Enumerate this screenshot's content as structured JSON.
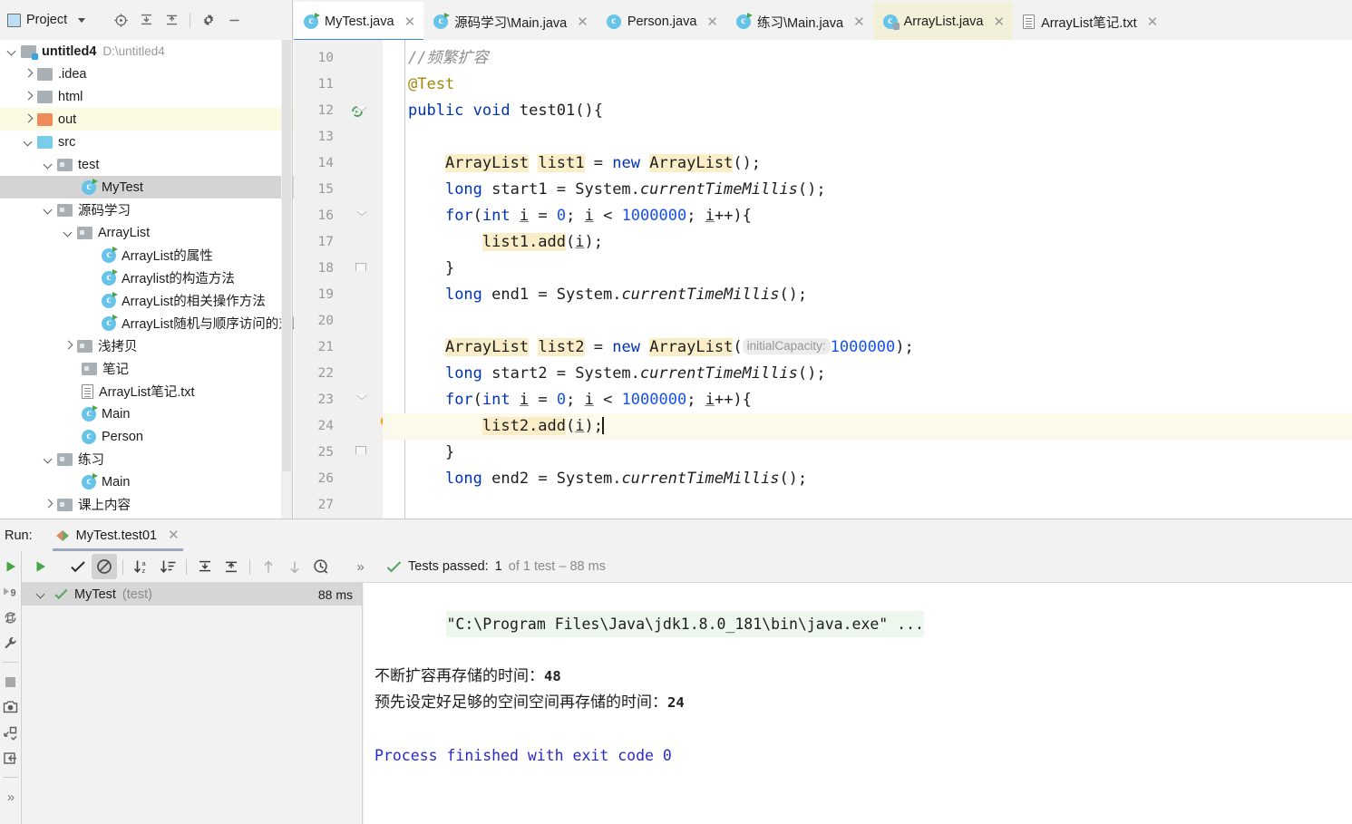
{
  "project_toolbar": {
    "title": "Project",
    "buttons": [
      {
        "name": "locate-icon",
        "tooltip": "Select Opened File"
      },
      {
        "name": "expand-all-icon",
        "tooltip": "Expand All"
      },
      {
        "name": "collapse-all-icon",
        "tooltip": "Collapse All"
      },
      {
        "name": "gear-icon",
        "tooltip": "Settings"
      },
      {
        "name": "hide-icon",
        "tooltip": "Hide"
      }
    ]
  },
  "tabs": [
    {
      "label": "MyTest.java",
      "icon": "java-class-runnable-icon",
      "state": "active"
    },
    {
      "label": "源码学习\\Main.java",
      "icon": "java-class-runnable-icon",
      "state": "normal"
    },
    {
      "label": "Person.java",
      "icon": "java-class-icon",
      "state": "normal"
    },
    {
      "label": "练习\\Main.java",
      "icon": "java-class-runnable-icon",
      "state": "normal"
    },
    {
      "label": "ArrayList.java",
      "icon": "java-class-locked-icon",
      "state": "library"
    },
    {
      "label": "ArrayList笔记.txt",
      "icon": "text-file-icon",
      "state": "normal"
    }
  ],
  "tree": [
    {
      "label": "untitled4",
      "path": "D:\\untitled4",
      "indent": 0,
      "arrow": "down",
      "icon": "module-folder-icon",
      "bold": true,
      "state": "normal"
    },
    {
      "label": ".idea",
      "indent": 1,
      "arrow": "right",
      "icon": "folder-gray-icon",
      "state": "normal"
    },
    {
      "label": "html",
      "indent": 1,
      "arrow": "right",
      "icon": "folder-gray-icon",
      "state": "normal"
    },
    {
      "label": "out",
      "indent": 1,
      "arrow": "right",
      "icon": "folder-orange-icon",
      "state": "highlighted"
    },
    {
      "label": "src",
      "indent": 1,
      "arrow": "down",
      "icon": "folder-blue-icon",
      "state": "normal"
    },
    {
      "label": "test",
      "indent": 2,
      "arrow": "down",
      "icon": "folder-package-icon",
      "state": "normal"
    },
    {
      "label": "MyTest",
      "indent": 3,
      "arrow": "none",
      "icon": "java-class-runnable-icon",
      "state": "selected"
    },
    {
      "label": "源码学习",
      "indent": 2,
      "arrow": "down",
      "icon": "folder-package-icon",
      "state": "normal"
    },
    {
      "label": "ArrayList",
      "indent": 3,
      "arrow": "down",
      "icon": "folder-package-icon",
      "state": "normal"
    },
    {
      "label": "ArrayList的属性",
      "indent": 4,
      "arrow": "none",
      "icon": "java-class-runnable-icon",
      "state": "normal"
    },
    {
      "label": "Arraylist的构造方法",
      "indent": 4,
      "arrow": "none",
      "icon": "java-class-runnable-icon",
      "state": "normal"
    },
    {
      "label": "ArrayList的相关操作方法",
      "indent": 4,
      "arrow": "none",
      "icon": "java-class-runnable-icon",
      "state": "normal"
    },
    {
      "label": "ArrayList随机与顺序访问的对比",
      "indent": 4,
      "arrow": "none",
      "icon": "java-class-runnable-icon",
      "state": "normal"
    },
    {
      "label": "浅拷贝",
      "indent": 3,
      "arrow": "right",
      "icon": "folder-package-icon",
      "state": "normal"
    },
    {
      "label": "笔记",
      "indent": 3,
      "arrow": "none",
      "icon": "folder-package-icon",
      "state": "normal"
    },
    {
      "label": "ArrayList笔记.txt",
      "indent": 3,
      "arrow": "none",
      "icon": "text-file-icon",
      "state": "normal"
    },
    {
      "label": "Main",
      "indent": 3,
      "arrow": "none",
      "icon": "java-class-runnable-icon",
      "state": "normal"
    },
    {
      "label": "Person",
      "indent": 3,
      "arrow": "none",
      "icon": "java-class-icon",
      "state": "normal"
    },
    {
      "label": "练习",
      "indent": 2,
      "arrow": "down",
      "icon": "folder-package-icon",
      "state": "normal"
    },
    {
      "label": "Main",
      "indent": 3,
      "arrow": "none",
      "icon": "java-class-runnable-icon",
      "state": "normal"
    },
    {
      "label": "课上内容",
      "indent": 2,
      "arrow": "right",
      "icon": "folder-package-icon",
      "state": "normal"
    }
  ],
  "editor": {
    "first_line": 10,
    "current_line": 24,
    "lines": [
      {
        "n": 10,
        "code": "//频繁扩容"
      },
      {
        "n": 11,
        "code": "@Test"
      },
      {
        "n": 12,
        "code": "public void test01(){"
      },
      {
        "n": 13,
        "code": ""
      },
      {
        "n": 14,
        "code": "ArrayList list1 = new ArrayList();"
      },
      {
        "n": 15,
        "code": "long start1 = System.currentTimeMillis();"
      },
      {
        "n": 16,
        "code": "for(int i = 0; i < 1000000; i++){"
      },
      {
        "n": 17,
        "code": "list1.add(i);"
      },
      {
        "n": 18,
        "code": "}"
      },
      {
        "n": 19,
        "code": "long end1 = System.currentTimeMillis();"
      },
      {
        "n": 20,
        "code": ""
      },
      {
        "n": 21,
        "code": "ArrayList list2 = new ArrayList( initialCapacity: 1000000);"
      },
      {
        "n": 22,
        "code": "long start2 = System.currentTimeMillis();"
      },
      {
        "n": 23,
        "code": "for(int i = 0; i < 1000000; i++){"
      },
      {
        "n": 24,
        "code": "list2.add(i);"
      },
      {
        "n": 25,
        "code": "}"
      },
      {
        "n": 26,
        "code": "long end2 = System.currentTimeMillis();"
      },
      {
        "n": 27,
        "code": ""
      }
    ],
    "param_hint": "initialCapacity:",
    "param_hint_value": "1000000"
  },
  "run_panel": {
    "run_label": "Run:",
    "tab_label": "MyTest.test01",
    "toolbar_buttons": [
      {
        "name": "rerun-button"
      },
      {
        "name": "show-passed-button"
      },
      {
        "name": "hide-ignored-button"
      },
      {
        "name": "sort-alphabetically-button"
      },
      {
        "name": "sort-by-duration-button"
      },
      {
        "name": "expand-all-button"
      },
      {
        "name": "collapse-all-button"
      },
      {
        "name": "previous-failed-button"
      },
      {
        "name": "next-failed-button"
      },
      {
        "name": "history-button"
      },
      {
        "name": "more-button"
      }
    ],
    "side_buttons": [
      {
        "name": "run-button"
      },
      {
        "name": "rerun-failed-button"
      },
      {
        "name": "rerun-automatically-button"
      },
      {
        "name": "settings-wrench-button"
      },
      {
        "name": "stop-button"
      },
      {
        "name": "screenshot-button"
      },
      {
        "name": "export-button"
      },
      {
        "name": "import-button"
      },
      {
        "name": "expand-more-button"
      }
    ],
    "status": {
      "prefix": "Tests passed:",
      "count": "1",
      "suffix": "of 1 test – 88 ms"
    },
    "test_tree": [
      {
        "label": "MyTest",
        "suffix": "(test)",
        "duration": "88 ms",
        "status": "passed"
      }
    ],
    "console": [
      {
        "text": "\"C:\\Program Files\\Java\\jdk1.8.0_181\\bin\\java.exe\" ...",
        "style": "command"
      },
      {
        "text": "不断扩容再存储的时间：",
        "value": "48",
        "style": "cn"
      },
      {
        "text": "预先设定好足够的空间空间再存储的时间：",
        "value": "24",
        "style": "cn"
      },
      {
        "text": "",
        "style": "blank"
      },
      {
        "text": "Process finished with exit code 0",
        "style": "exit"
      }
    ]
  },
  "colors": {
    "accent_tab": "#4083c9",
    "keyword": "#0033b3",
    "number": "#1750eb",
    "comment": "#8c8c8c",
    "annotation": "#9e880d",
    "highlight_identifier": "#faeec8",
    "library_tab": "#f2f0d8",
    "success_green": "#49a349",
    "console_command_bg": "#edf7ed",
    "exit_code_blue": "#2929c9",
    "current_line": "#fcfaeb"
  }
}
